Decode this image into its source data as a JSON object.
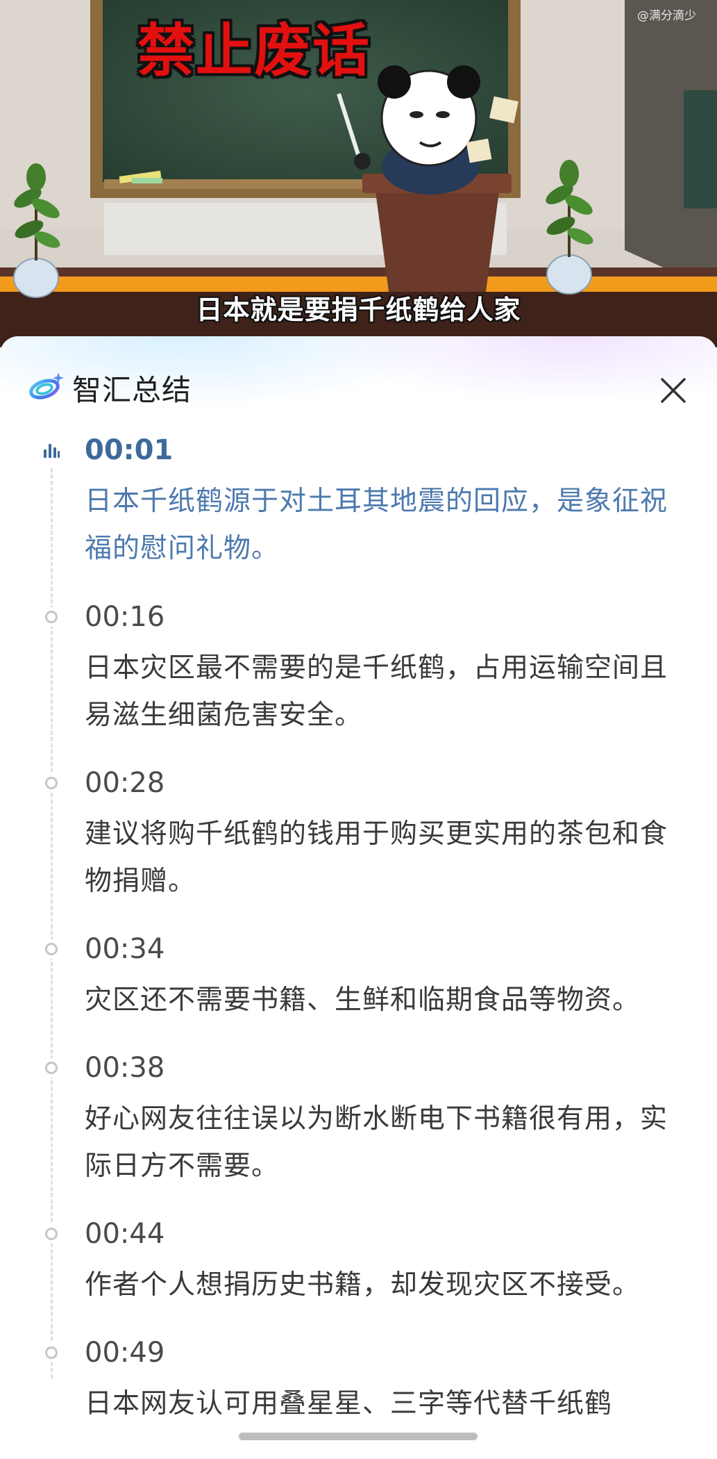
{
  "video": {
    "title_overlay": "禁止废话",
    "watermark": "@满分滴少",
    "subtitle": "日本就是要捐千纸鹤给人家"
  },
  "panel": {
    "title": "智汇总结",
    "logo_icon": "swirl-logo-icon",
    "close_icon": "close-icon"
  },
  "summary": {
    "entries": [
      {
        "time": "00:01",
        "text": "日本千纸鹤源于对土耳其地震的回应，是象征祝福的慰问礼物。",
        "active": true
      },
      {
        "time": "00:16",
        "text": "日本灾区最不需要的是千纸鹤，占用运输空间且易滋生细菌危害安全。",
        "active": false
      },
      {
        "time": "00:28",
        "text": "建议将购千纸鹤的钱用于购买更实用的茶包和食物捐赠。",
        "active": false
      },
      {
        "time": "00:34",
        "text": "灾区还不需要书籍、生鲜和临期食品等物资。",
        "active": false
      },
      {
        "time": "00:38",
        "text": "好心网友往往误以为断水断电下书籍很有用，实际日方不需要。",
        "active": false
      },
      {
        "time": "00:44",
        "text": "作者个人想捐历史书籍，却发现灾区不接受。",
        "active": false
      },
      {
        "time": "00:49",
        "text": "日本网友认可用叠星星、三字等代替千纸鹤",
        "active": false
      }
    ]
  },
  "colors": {
    "active_time": "#3e6a9a",
    "active_text": "#4c79ae",
    "inactive_text": "#3a3a3a",
    "timeline_dot": "#c6c6c6"
  }
}
